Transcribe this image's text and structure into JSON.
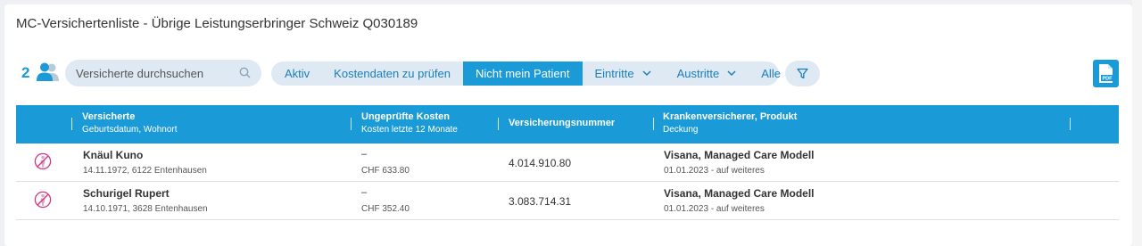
{
  "page": {
    "title": "MC-Versichertenliste - Übrige Leistungserbringer Schweiz Q030189"
  },
  "toolbar": {
    "count": "2",
    "search_placeholder": "Versicherte durchsuchen",
    "filters": [
      {
        "label": "Aktiv",
        "active": false,
        "dropdown": false
      },
      {
        "label": "Kostendaten zu prüfen",
        "active": false,
        "dropdown": false
      },
      {
        "label": "Nicht mein Patient",
        "active": true,
        "dropdown": false
      },
      {
        "label": "Eintritte",
        "active": false,
        "dropdown": true
      },
      {
        "label": "Austritte",
        "active": false,
        "dropdown": true
      },
      {
        "label": "Alle",
        "active": false,
        "dropdown": false
      }
    ],
    "pdf_label": "PDF",
    "colors": {
      "accent": "#1a9bd7",
      "pill": "#dfe9f3",
      "status_icon": "#d63384"
    },
    "icons": [
      "users-icon",
      "search-icon",
      "chevron-down-icon",
      "filter-icon",
      "pdf-icon",
      "patient-excluded-icon"
    ]
  },
  "table": {
    "columns": [
      {
        "title": "Versicherte",
        "sub": "Geburtsdatum, Wohnort"
      },
      {
        "title": "Ungeprüfte Kosten",
        "sub": "Kosten letzte 12 Monate"
      },
      {
        "title": "Versicherungsnummer",
        "sub": ""
      },
      {
        "title": "Krankenversicherer, Produkt",
        "sub": "Deckung"
      }
    ],
    "rows": [
      {
        "name": "Knäul Kuno",
        "birth_place": "14.11.1972, 6122 Entenhausen",
        "unchecked_costs": "–",
        "costs_12m": "CHF 633.80",
        "insurance_number": "4.014.910.80",
        "insurer_product": "Visana, Managed Care Modell",
        "coverage": "01.01.2023 - auf weiteres"
      },
      {
        "name": "Schurigel Rupert",
        "birth_place": "14.10.1971, 3628 Entenhausen",
        "unchecked_costs": "–",
        "costs_12m": "CHF 352.40",
        "insurance_number": "3.083.714.31",
        "insurer_product": "Visana, Managed Care Modell",
        "coverage": "01.01.2023 - auf weiteres"
      }
    ]
  }
}
